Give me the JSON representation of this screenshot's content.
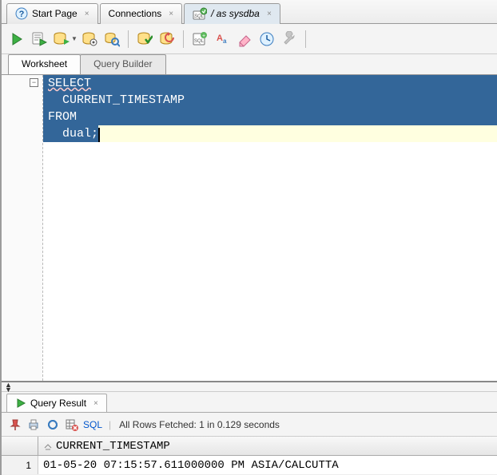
{
  "tabs": {
    "start": "Start Page",
    "connections": "Connections",
    "session": "/ as sysdba"
  },
  "ws_tabs": {
    "worksheet": "Worksheet",
    "query_builder": "Query Builder"
  },
  "editor": {
    "line1": "SELECT",
    "line2": "  CURRENT_TIMESTAMP",
    "line3": "FROM",
    "line4_sel": "  dual;",
    "line4_rest": ""
  },
  "result_tab": "Query Result",
  "result_toolbar": {
    "sql_link": "SQL",
    "status": "All Rows Fetched: 1 in 0.129 seconds"
  },
  "result_grid": {
    "column": "CURRENT_TIMESTAMP",
    "rownum": "1",
    "value": "01-05-20 07:15:57.611000000 PM ASIA/CALCUTTA"
  },
  "icons": {
    "help": "help",
    "plug": "plug",
    "sql": "sql"
  }
}
